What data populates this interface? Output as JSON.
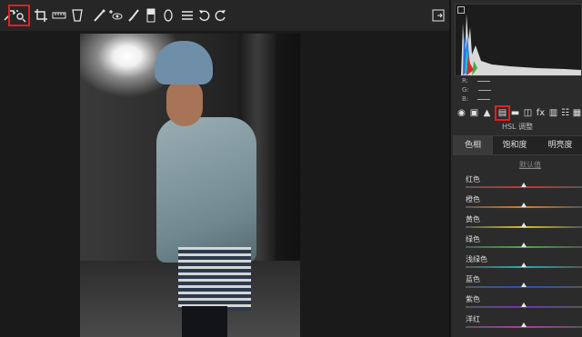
{
  "toolbar": {
    "tools": [
      {
        "name": "zoom-icon",
        "glyph": "⤢"
      },
      {
        "name": "targeted-adjustment-icon",
        "glyph": "⊚",
        "selected": true
      },
      {
        "name": "crop-icon",
        "glyph": "⌐"
      },
      {
        "name": "straighten-icon",
        "glyph": "▭"
      },
      {
        "name": "transform-icon",
        "glyph": "⌑"
      },
      {
        "name": "spot-removal-icon",
        "glyph": "⁄"
      },
      {
        "name": "red-eye-icon",
        "glyph": "+◉"
      },
      {
        "name": "adjustment-brush-icon",
        "glyph": "✎"
      },
      {
        "name": "graduated-filter-icon",
        "glyph": "▯"
      },
      {
        "name": "radial-filter-icon",
        "glyph": "◯"
      },
      {
        "name": "preferences-icon",
        "glyph": "☰"
      },
      {
        "name": "rotate-left-icon",
        "glyph": "↺"
      },
      {
        "name": "rotate-right-icon",
        "glyph": "↻"
      }
    ],
    "fullscreen_icon": "⧉"
  },
  "histogram": {
    "readouts": [
      {
        "label": "R:",
        "value": "---"
      },
      {
        "label": "G:",
        "value": "---"
      },
      {
        "label": "B:",
        "value": "---"
      }
    ]
  },
  "panel_tabs": [
    {
      "name": "basic-panel-icon",
      "glyph": "◉"
    },
    {
      "name": "tone-curve-icon",
      "glyph": "▣"
    },
    {
      "name": "detail-icon",
      "glyph": "▲"
    },
    {
      "name": "hsl-icon",
      "glyph": "▤",
      "selected": true
    },
    {
      "name": "split-toning-icon",
      "glyph": "▬"
    },
    {
      "name": "lens-corrections-icon",
      "glyph": "◫"
    },
    {
      "name": "effects-icon",
      "glyph": "fx"
    },
    {
      "name": "camera-calibration-icon",
      "glyph": "▥"
    },
    {
      "name": "presets-icon",
      "glyph": "☷"
    },
    {
      "name": "snapshots-icon",
      "glyph": "▦"
    }
  ],
  "panel_title": "HSL 调整",
  "hsl_tabs": [
    "色相",
    "饱和度",
    "明亮度"
  ],
  "default_link": "默认值",
  "sliders": [
    {
      "label": "红色",
      "value": 0,
      "color": "#d23030"
    },
    {
      "label": "橙色",
      "value": 0,
      "color": "#e07a20"
    },
    {
      "label": "黄色",
      "value": 0,
      "color": "#d8c020"
    },
    {
      "label": "绿色",
      "value": 0,
      "color": "#40b040"
    },
    {
      "label": "浅绿色",
      "value": 0,
      "color": "#20b0b0"
    },
    {
      "label": "蓝色",
      "value": 0,
      "color": "#2050d0"
    },
    {
      "label": "紫色",
      "value": 0,
      "color": "#7030c0"
    },
    {
      "label": "洋红",
      "value": 0,
      "color": "#c030b0"
    }
  ]
}
